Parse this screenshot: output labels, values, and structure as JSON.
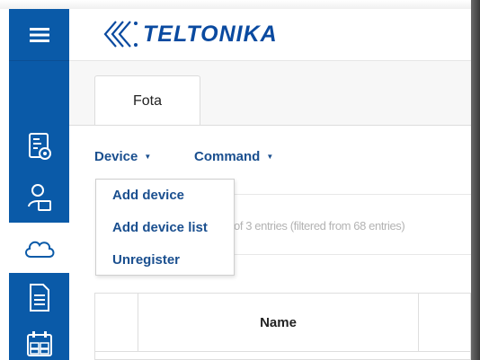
{
  "app": {
    "brand": "TELTONIKA",
    "brand_color": "#0a4aa0",
    "sidebar_color": "#0a5aa8"
  },
  "sidebar": {
    "items": [
      {
        "icon": "menu-icon",
        "active": false
      },
      {
        "icon": "device-settings-icon",
        "active": false
      },
      {
        "icon": "user-keyboard-icon",
        "active": false
      },
      {
        "icon": "cloud-icon",
        "active": true
      },
      {
        "icon": "document-icon",
        "active": false
      },
      {
        "icon": "calendar-icon",
        "active": false
      }
    ]
  },
  "tabs": [
    {
      "label": "Fota",
      "active": true
    }
  ],
  "toolbar": {
    "device_label": "Device",
    "command_label": "Command"
  },
  "device_menu": {
    "items": [
      "Add device",
      "Add device list",
      "Unregister"
    ]
  },
  "table_info": "of 3 entries (filtered from 68 entries)",
  "table": {
    "columns": [
      "",
      "Name",
      ""
    ]
  }
}
